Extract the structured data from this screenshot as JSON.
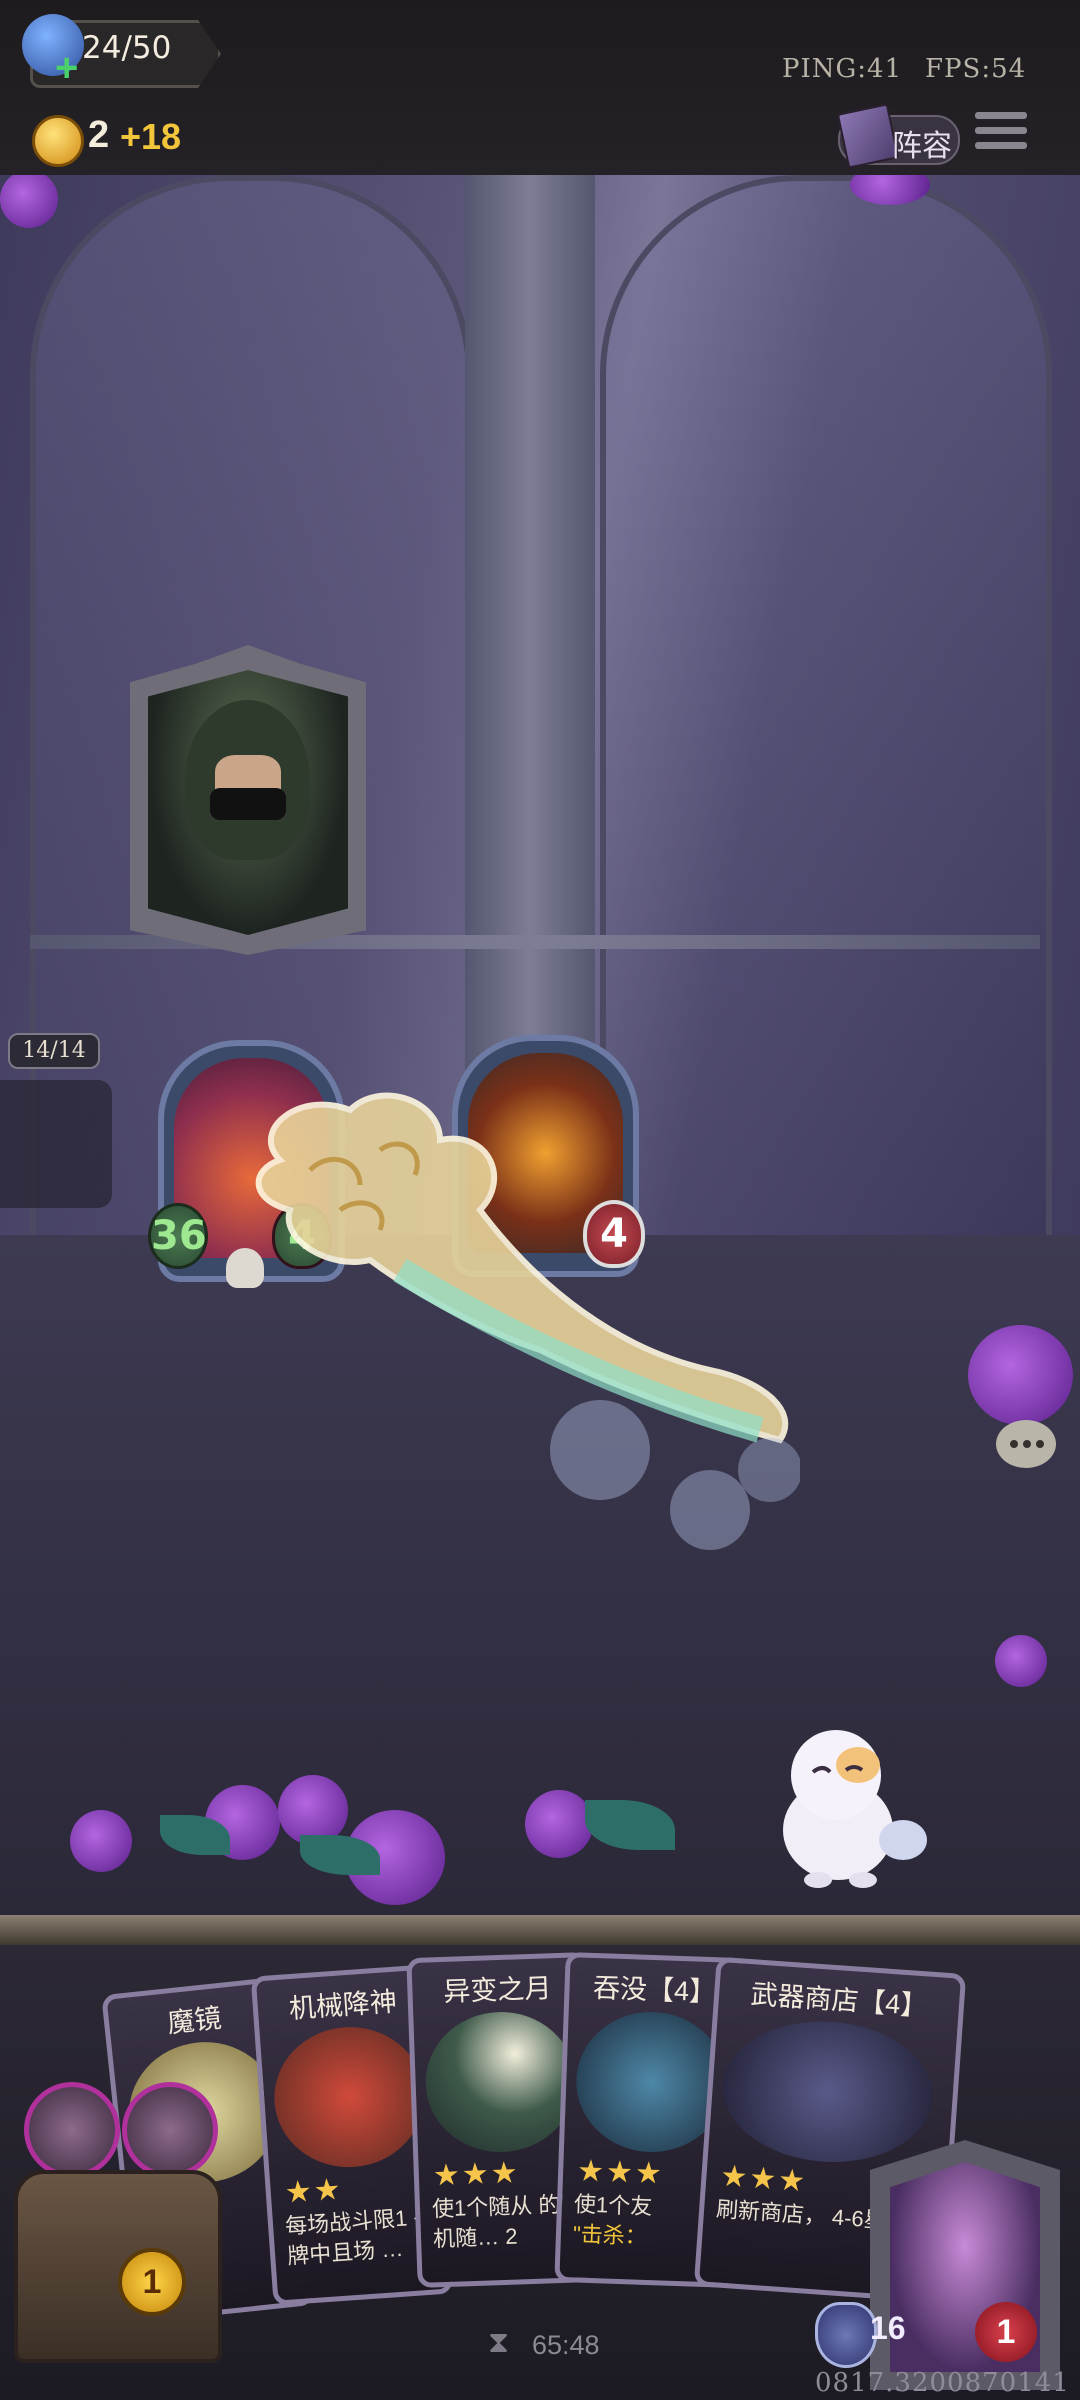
{
  "hud": {
    "population": "24/50",
    "ping": "PING:41",
    "fps": "FPS:54",
    "gold": "2",
    "gold_gain": "+18",
    "lineup_label": "阵容"
  },
  "board": {
    "minion_count": "14/14",
    "minions": [
      {
        "attack": "36",
        "health": "4"
      },
      {
        "attack": "",
        "health": "4"
      }
    ]
  },
  "shop": {
    "cards": [
      {
        "title": "魔镜",
        "stars": "★★",
        "text": ""
      },
      {
        "title": "机械降神",
        "stars": "★★",
        "text": "每场战斗限1 手牌中且场 …"
      },
      {
        "title": "异变之月",
        "stars": "★★★",
        "text": "使1个随从 的随机随… 2"
      },
      {
        "title": "吞没【4】",
        "stars": "★★★",
        "text": "使1个友",
        "highlight": "\"击杀："
      },
      {
        "title": "武器商店【4】",
        "stars": "★★★",
        "text": "刷新商店， 4-6星"
      }
    ],
    "reroll_cost": "1",
    "timer": "65:48"
  },
  "hero": {
    "armor": "16",
    "health": "1"
  },
  "build_id": "0817.3200870141",
  "colors": {
    "gold": "#f3c53a",
    "attack_green": "#9ee890",
    "health_red": "#c34a52",
    "card_border": "#8a7ea0"
  }
}
